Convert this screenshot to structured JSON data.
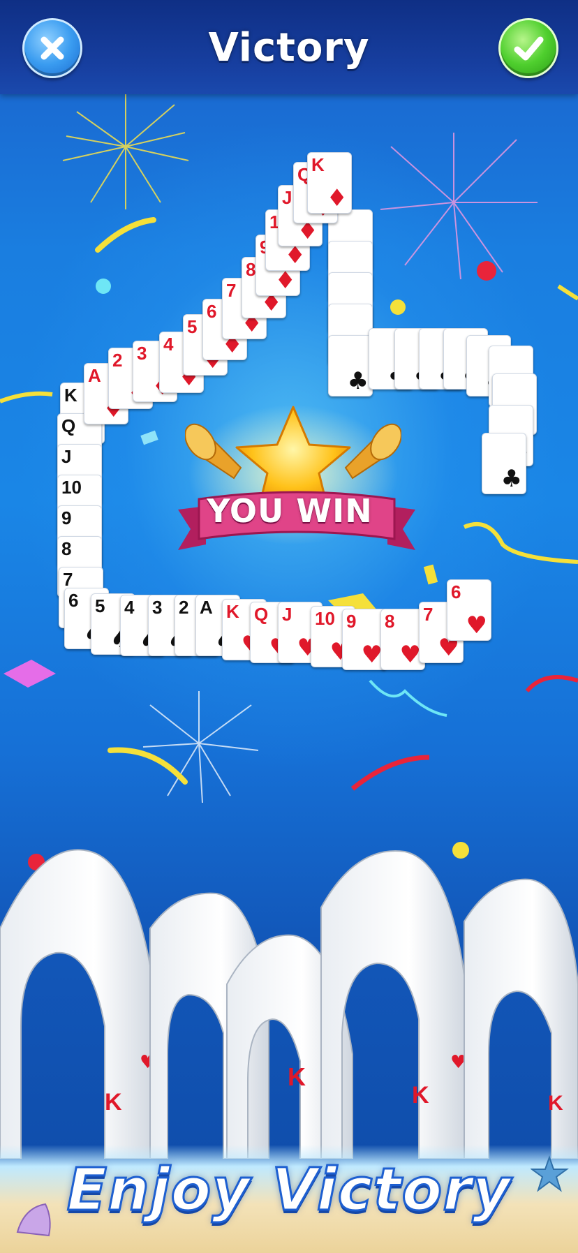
{
  "header": {
    "title": "Victory",
    "close_icon": "close-x-icon",
    "confirm_icon": "checkmark-icon",
    "close_color": "#3a9cf0",
    "confirm_color": "#4fcf2e"
  },
  "banner": {
    "text": "YOU WIN",
    "ribbon_color": "#d83d7c",
    "star_color": "#ffc21a"
  },
  "cards": [
    {
      "rank": "K",
      "suit": "♠"
    },
    {
      "rank": "Q",
      "suit": "♠"
    },
    {
      "rank": "J",
      "suit": "♠"
    },
    {
      "rank": "10",
      "suit": "♠"
    },
    {
      "rank": "9",
      "suit": "♠"
    },
    {
      "rank": "8",
      "suit": "♠"
    },
    {
      "rank": "7",
      "suit": "♠"
    },
    {
      "rank": "6",
      "suit": "♠"
    },
    {
      "rank": "5",
      "suit": "♠"
    },
    {
      "rank": "4",
      "suit": "♠"
    },
    {
      "rank": "3",
      "suit": "♠"
    },
    {
      "rank": "2",
      "suit": "♠"
    },
    {
      "rank": "A",
      "suit": "♠"
    },
    {
      "rank": "K",
      "suit": "♥"
    },
    {
      "rank": "Q",
      "suit": "♥"
    },
    {
      "rank": "J",
      "suit": "♥"
    },
    {
      "rank": "10",
      "suit": "♥"
    },
    {
      "rank": "9",
      "suit": "♥"
    },
    {
      "rank": "8",
      "suit": "♥"
    },
    {
      "rank": "7",
      "suit": "♥"
    },
    {
      "rank": "6",
      "suit": "♥"
    },
    {
      "rank": "A",
      "suit": "♦"
    },
    {
      "rank": "2",
      "suit": "♦"
    },
    {
      "rank": "3",
      "suit": "♦"
    },
    {
      "rank": "4",
      "suit": "♦"
    },
    {
      "rank": "5",
      "suit": "♦"
    },
    {
      "rank": "6",
      "suit": "♦"
    },
    {
      "rank": "7",
      "suit": "♦"
    },
    {
      "rank": "8",
      "suit": "♦"
    },
    {
      "rank": "9",
      "suit": "♦"
    },
    {
      "rank": "10",
      "suit": "♦"
    },
    {
      "rank": "J",
      "suit": "♦"
    },
    {
      "rank": "Q",
      "suit": "♦"
    },
    {
      "rank": "K",
      "suit": "♦"
    }
  ],
  "tagline": "Enjoy Victory",
  "colors": {
    "background": "#1a7ee0",
    "header": "#173fa0",
    "tagline_stroke": "#1d5fd1"
  }
}
